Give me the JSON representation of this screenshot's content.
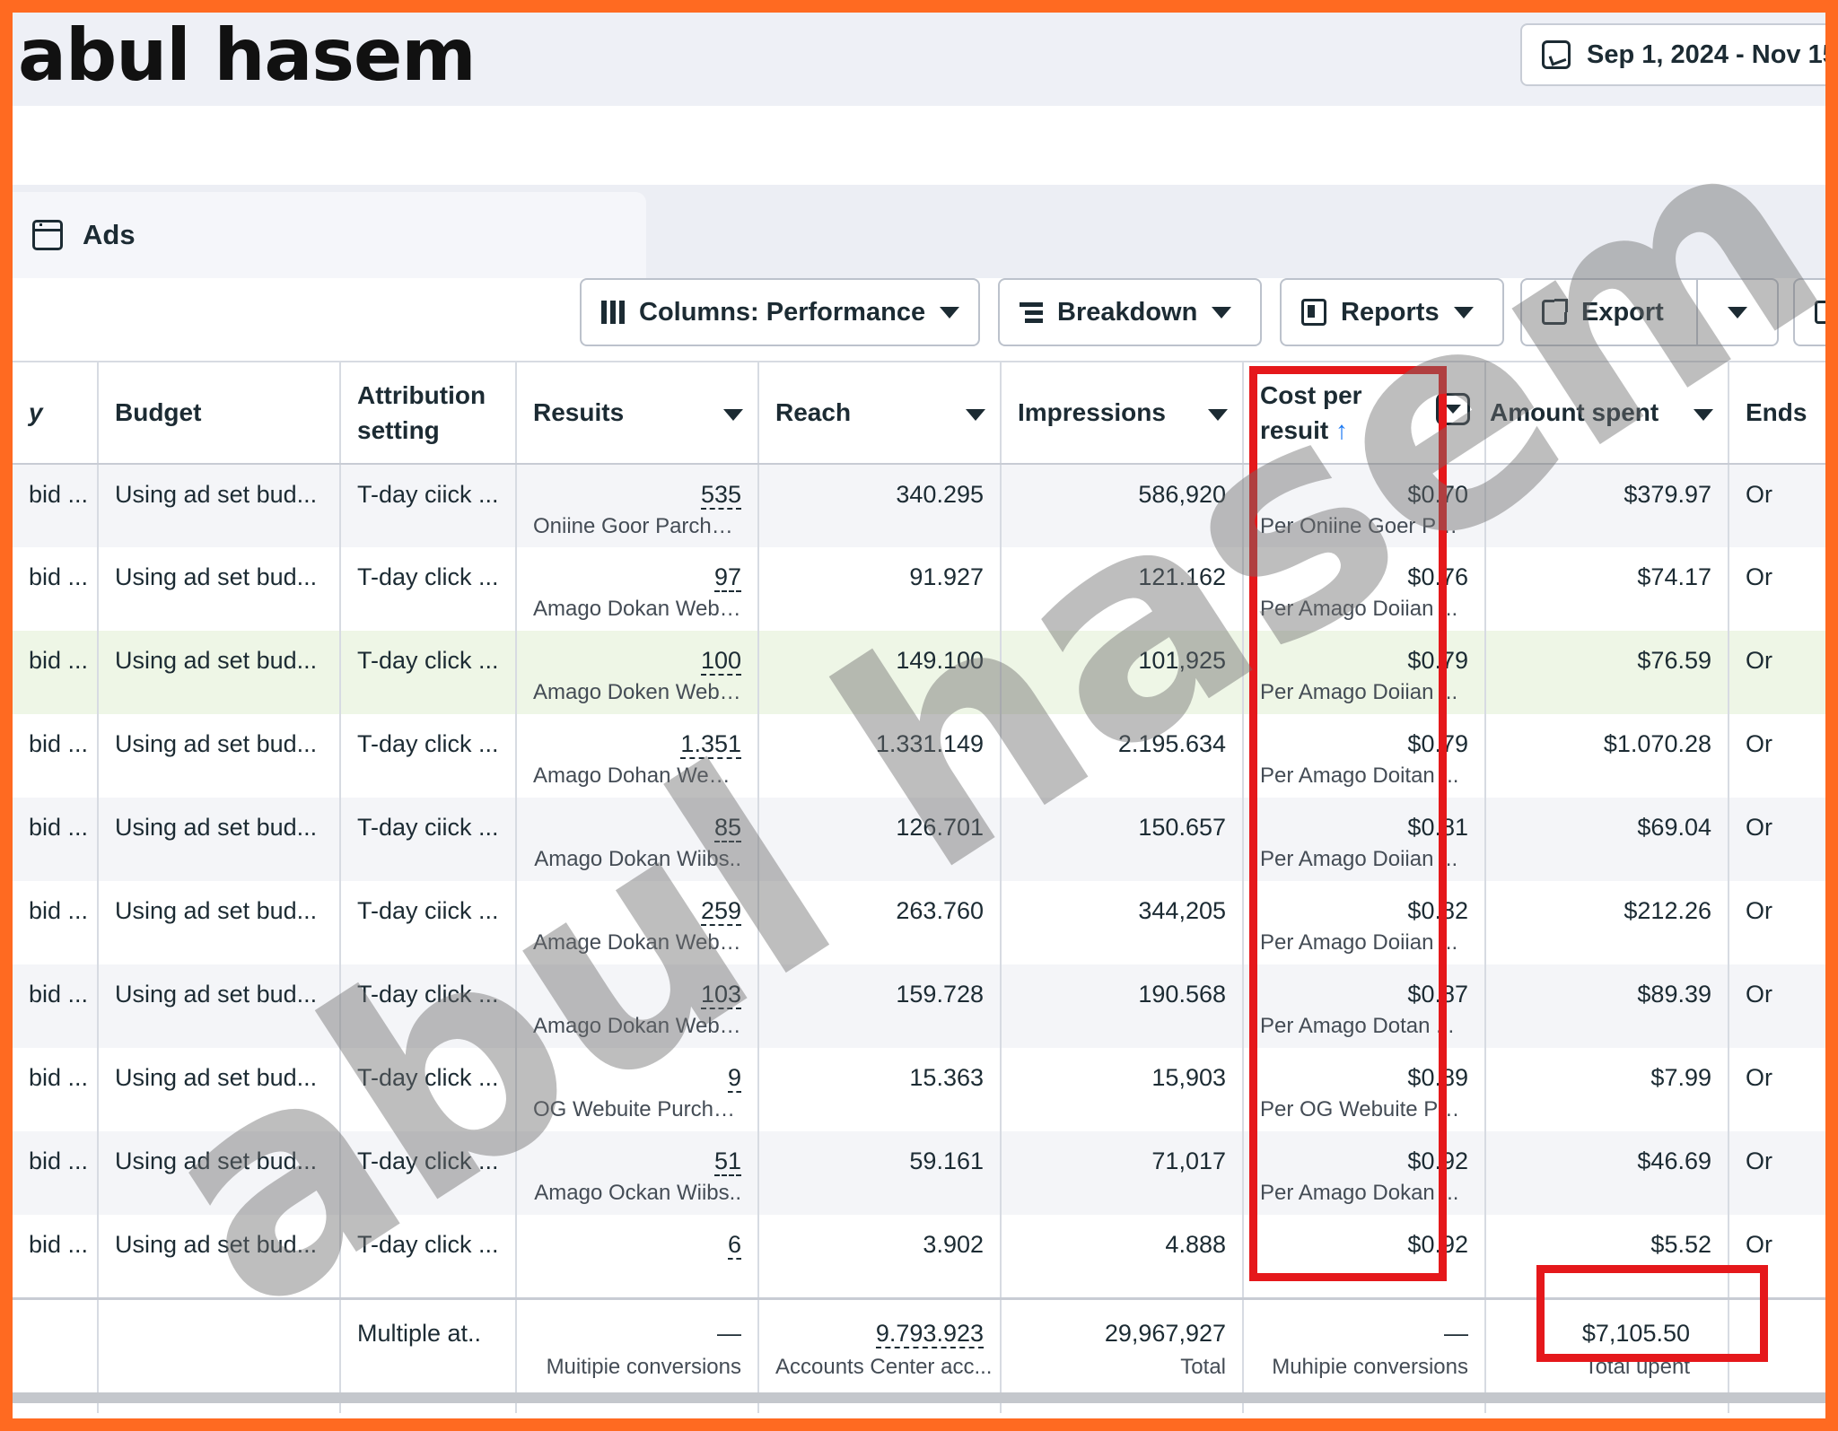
{
  "account": {
    "title": "abul hasem",
    "date_range": "Sep 1, 2024 - Nov 15"
  },
  "tabs": {
    "ads_label": "Ads"
  },
  "toolbar": {
    "columns_label": "Columns: Performance",
    "breakdown_label": "Breakdown",
    "reports_label": "Reports",
    "export_label": "Export"
  },
  "table": {
    "columns": {
      "bid": "y",
      "budget": "Budget",
      "attribution": "Attribution setting",
      "results": "Resuits",
      "reach": "Reach",
      "impressions": "Impressions",
      "cpr_line1": "Cost per",
      "cpr_line2": "resuit",
      "cpr_sort": "↑",
      "amount": "Amount spent",
      "ends": "Ends"
    },
    "rows": [
      {
        "bid": "bid ...",
        "budget": "Using ad set bud...",
        "attribution": "T-day ciick ...",
        "results": "535",
        "results_type": "Oniine Goor Parchase",
        "reach": "340.295",
        "impressions": "586,920",
        "cpr": "$0.70",
        "cpr_type": "Per Oniine Goer Pur...",
        "amount": "$379.97",
        "ends": "Or"
      },
      {
        "bid": "bid ...",
        "budget": "Using ad set bud...",
        "attribution": "T-day click ...",
        "results": "97",
        "results_type": "Amago Dokan Webs..",
        "reach": "91.927",
        "impressions": "121.162",
        "cpr": "$0.76",
        "cpr_type": "Per Amago Doiian ...",
        "amount": "$74.17",
        "ends": "Or"
      },
      {
        "bid": "bid ...",
        "budget": "Using ad set bud...",
        "attribution": "T-day click ...",
        "results": "100",
        "results_type": "Amago Doken Webs..",
        "reach": "149.100",
        "impressions": "101,925",
        "cpr": "$0.79",
        "cpr_type": "Per Amago Doiian ...",
        "amount": "$76.59",
        "ends": "Or"
      },
      {
        "bid": "bid ...",
        "budget": "Using ad set bud...",
        "attribution": "T-day click ...",
        "results": "1.351",
        "results_type": "Amago Dohan Webe..",
        "reach": "1.331.149",
        "impressions": "2.195.634",
        "cpr": "$0.79",
        "cpr_type": "Per Amago Doitan ...",
        "amount": "$1.070.28",
        "ends": "Or"
      },
      {
        "bid": "bid ...",
        "budget": "Using ad set bud...",
        "attribution": "T-day ciick ...",
        "results": "85",
        "results_type": "Amago Dokan Wiibs..",
        "reach": "126.701",
        "impressions": "150.657",
        "cpr": "$0.81",
        "cpr_type": "Per Amago Doiian ...",
        "amount": "$69.04",
        "ends": "Or"
      },
      {
        "bid": "bid ...",
        "budget": "Using ad set bud...",
        "attribution": "T-day ciick ...",
        "results": "259",
        "results_type": "Amage Dokan Webs..",
        "reach": "263.760",
        "impressions": "344,205",
        "cpr": "$0.82",
        "cpr_type": "Per Amago Doiian ...",
        "amount": "$212.26",
        "ends": "Or"
      },
      {
        "bid": "bid ...",
        "budget": "Using ad set bud...",
        "attribution": "T-day click ...",
        "results": "103",
        "results_type": "Amago Dokan Webe..",
        "reach": "159.728",
        "impressions": "190.568",
        "cpr": "$0.87",
        "cpr_type": "Per Amago Dotan ...",
        "amount": "$89.39",
        "ends": "Or"
      },
      {
        "bid": "bid ...",
        "budget": "Using ad set bud...",
        "attribution": "T-day click ...",
        "results": "9",
        "results_type": "OG Webuite Purchote",
        "reach": "15.363",
        "impressions": "15,903",
        "cpr": "$0.89",
        "cpr_type": "Per OG Webuite Pur...",
        "amount": "$7.99",
        "ends": "Or"
      },
      {
        "bid": "bid ...",
        "budget": "Using ad set bud...",
        "attribution": "T-day click ...",
        "results": "51",
        "results_type": "Amago Ockan Wiibs..",
        "reach": "59.161",
        "impressions": "71,017",
        "cpr": "$0.92",
        "cpr_type": "Per Amago Dokan ...",
        "amount": "$46.69",
        "ends": "Or"
      },
      {
        "bid": "bid ...",
        "budget": "Using ad set bud...",
        "attribution": "T-day click ...",
        "results": "6",
        "results_type": "",
        "reach": "3.902",
        "impressions": "4.888",
        "cpr": "$0.92",
        "cpr_type": "",
        "amount": "$5.52",
        "ends": "Or"
      }
    ],
    "totals": {
      "attribution": "Multiple at..",
      "results": "—",
      "results_sub": "Muitipie conversions",
      "reach": "9.793.923",
      "reach_sub": "Accounts Center acc...",
      "impressions": "29,967,927",
      "impressions_sub": "Total",
      "cpr": "—",
      "cpr_sub": "Muhipie conversions",
      "amount": "$7,105.50",
      "amount_sub": "Total upent"
    }
  },
  "watermark": "abul hasem",
  "colors": {
    "frame": "#ff6a21",
    "highlight_box": "#e5181b",
    "sort_arrow": "#1877f2",
    "highlighted_row": "#eef6e6"
  }
}
